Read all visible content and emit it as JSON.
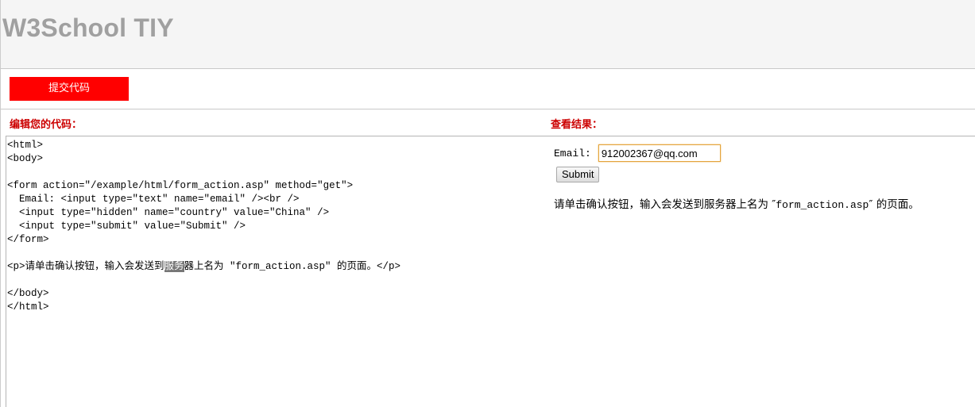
{
  "header": {
    "title": "W3School TIY"
  },
  "toolbar": {
    "submit_label": "提交代码"
  },
  "editor_panel": {
    "label": "编辑您的代码：",
    "lines": [
      "<html>",
      "<body>",
      "",
      "<form action=\"/example/html/form_action.asp\" method=\"get\">",
      "  Email: <input type=\"text\" name=\"email\" /><br />",
      "  <input type=\"hidden\" name=\"country\" value=\"China\" />",
      "  <input type=\"submit\" value=\"Submit\" />",
      "</form>",
      "",
      "<p>请单击确认按钮，输入会发送到",
      "服务",
      "器上名为 \"form_action.asp\" 的页面。</p>",
      "",
      "</body>",
      "</html>"
    ]
  },
  "result_panel": {
    "label": "查看结果：",
    "email_label": "Email:",
    "email_value": "912002367@qq.com",
    "submit_label": "Submit",
    "text_before": "请单击确认按钮，输入会发送到服务器上名为 ″",
    "text_code": "form_action.asp",
    "text_after": "″ 的页面。"
  },
  "colors": {
    "accent": "#ff0000",
    "label": "#cc0000",
    "header_bg": "#f5f5f5",
    "title": "#a0a0a0"
  }
}
